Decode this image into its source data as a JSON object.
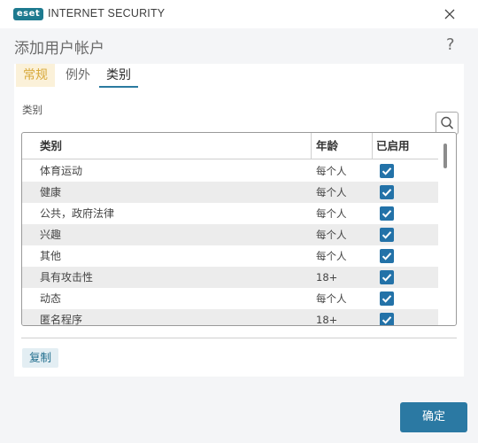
{
  "app": {
    "logo_text": "eset",
    "product_name": "INTERNET SECURITY"
  },
  "dialog": {
    "title": "添加用户帐户",
    "help_label": "?"
  },
  "tabs": [
    {
      "label": "常规"
    },
    {
      "label": "例外"
    },
    {
      "label": "类别"
    }
  ],
  "section_label": "类别",
  "table": {
    "headers": {
      "category": "类别",
      "age": "年龄",
      "enabled": "已启用"
    },
    "rows": [
      {
        "category": "体育运动",
        "age": "每个人",
        "enabled": true
      },
      {
        "category": "健康",
        "age": "每个人",
        "enabled": true
      },
      {
        "category": "公共，政府法律",
        "age": "每个人",
        "enabled": true
      },
      {
        "category": "兴趣",
        "age": "每个人",
        "enabled": true
      },
      {
        "category": "其他",
        "age": "每个人",
        "enabled": true
      },
      {
        "category": "具有攻击性",
        "age": "18+",
        "enabled": true
      },
      {
        "category": "动态",
        "age": "每个人",
        "enabled": true
      },
      {
        "category": "匿名程序",
        "age": "18+",
        "enabled": true
      }
    ]
  },
  "buttons": {
    "copy": "复制",
    "ok": "确定"
  },
  "colors": {
    "accent": "#2b79a3",
    "checkbox": "#2372a8",
    "logo": "#1d7a8f",
    "tab_highlight": "#fbf1d9"
  }
}
